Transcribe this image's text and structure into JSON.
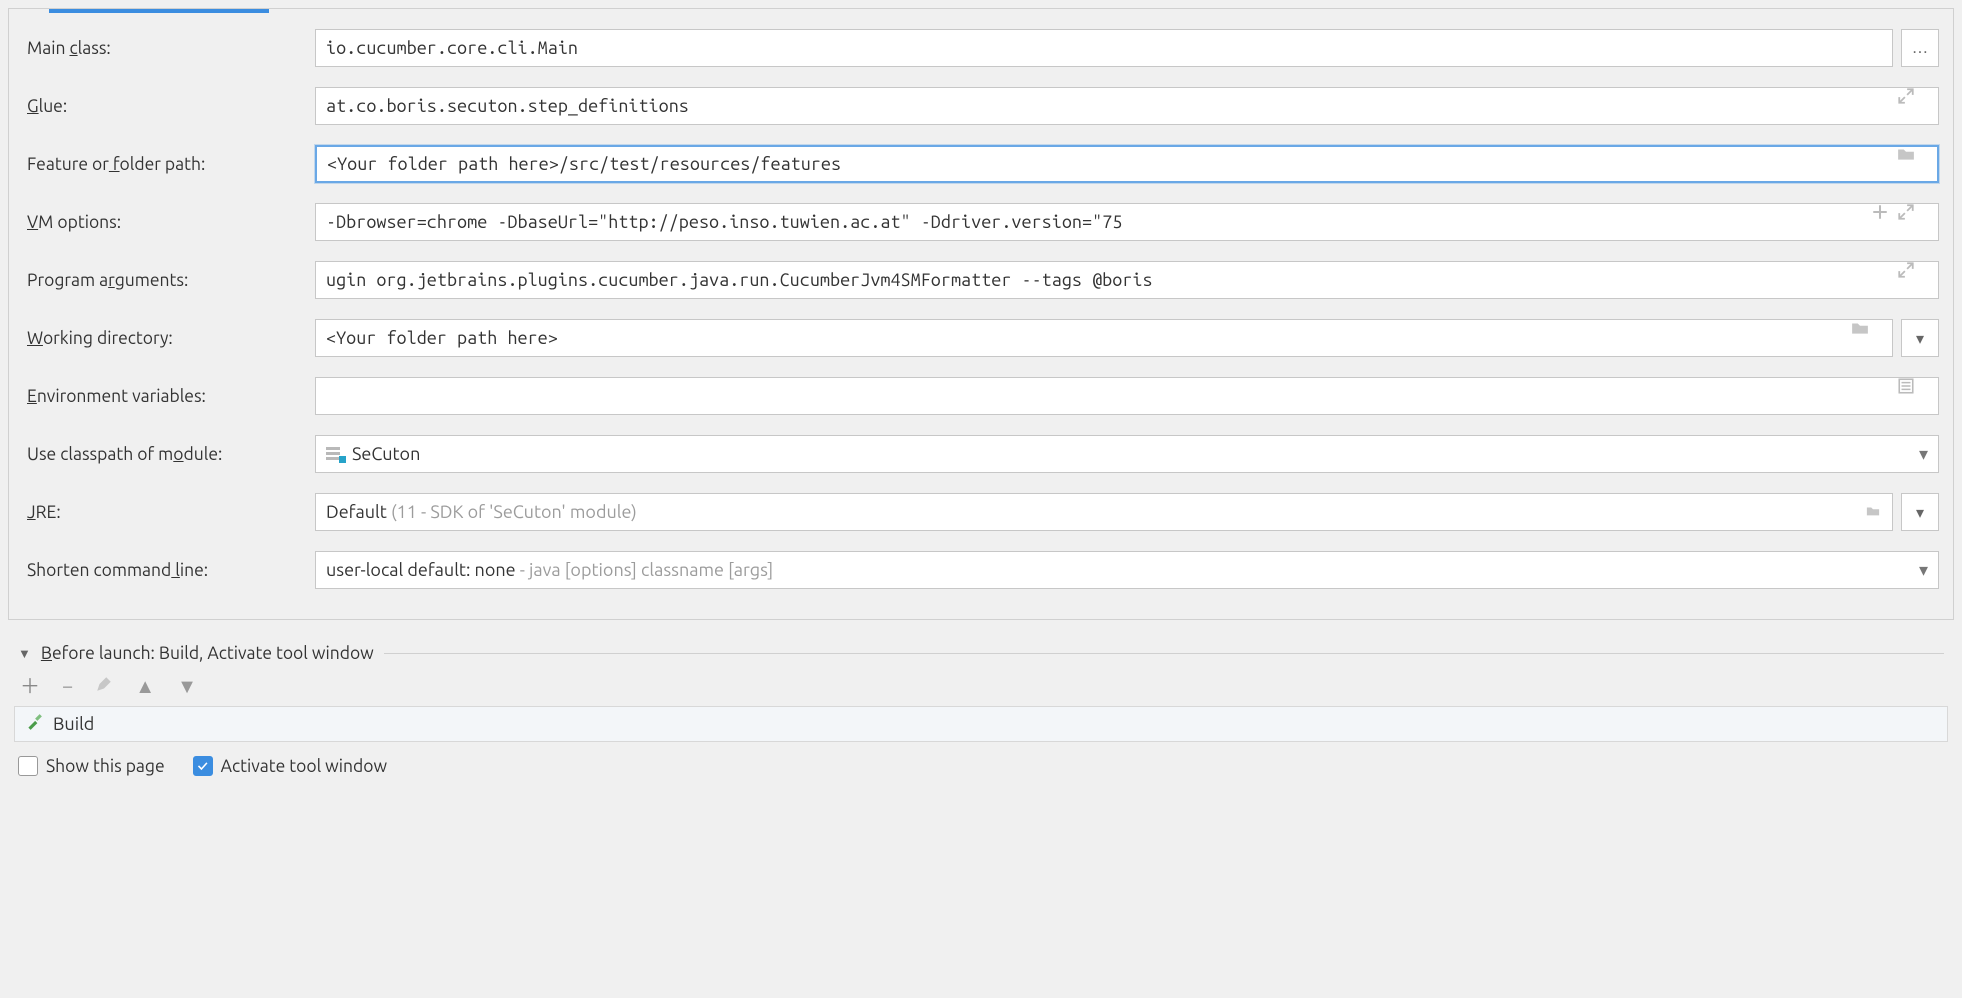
{
  "labels": {
    "main_class": "Main class:",
    "glue": "Glue:",
    "feature_path": "Feature or folder path:",
    "vm_options": "VM options:",
    "program_args": "Program arguments:",
    "working_dir": "Working directory:",
    "env_vars": "Environment variables:",
    "classpath_module": "Use classpath of module:",
    "jre": "JRE:",
    "shorten_cmd": "Shorten command line:"
  },
  "values": {
    "main_class": "io.cucumber.core.cli.Main",
    "glue": "at.co.boris.secuton.step_definitions",
    "feature_path": "<Your folder path here>/src/test/resources/features",
    "vm_options": "-Dbrowser=chrome -DbaseUrl=\"http://peso.inso.tuwien.ac.at\" -Ddriver.version=\"75",
    "program_args": "ugin org.jetbrains.plugins.cucumber.java.run.CucumberJvm4SMFormatter --tags @boris",
    "working_dir": "<Your folder path here>",
    "env_vars": "",
    "classpath_module": "SeCuton",
    "jre_main": "Default ",
    "jre_hint": "(11 - SDK of 'SeCuton' module)",
    "shorten_main": "user-local default: none ",
    "shorten_hint": "- java [options] classname [args]"
  },
  "before_launch": {
    "title": "Before launch: Build, Activate tool window",
    "item": "Build"
  },
  "footer": {
    "show_page": "Show this page",
    "activate_tool": "Activate tool window"
  }
}
